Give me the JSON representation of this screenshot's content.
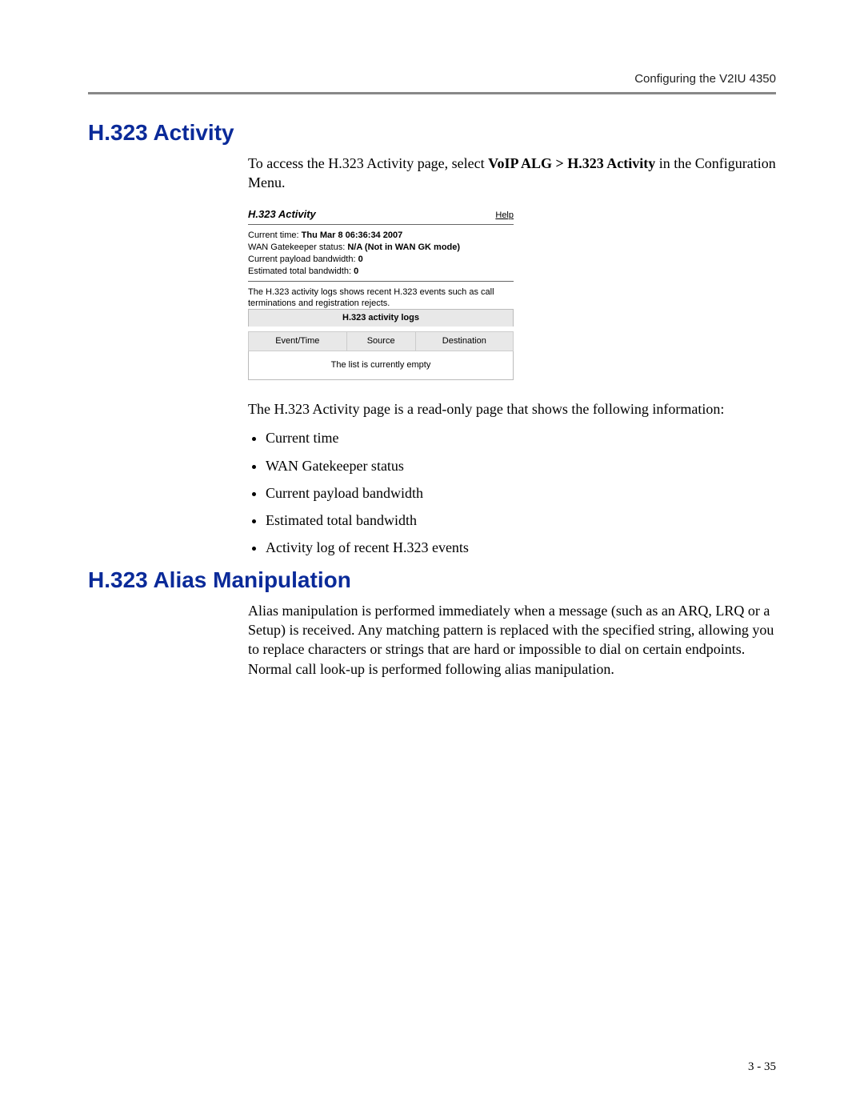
{
  "running_head": "Configuring the V2IU 4350",
  "section1": {
    "heading": "H.323 Activity",
    "intro_pre": "To access the H.323 Activity page, select ",
    "intro_path": "VoIP ALG > H.323 Activity",
    "intro_post": " in the Configuration Menu.",
    "after_panel": "The H.323 Activity page is a read-only page that shows the following information:",
    "bullets": [
      "Current time",
      "WAN Gatekeeper status",
      "Current payload bandwidth",
      "Estimated total bandwidth",
      "Activity log of recent H.323 events"
    ]
  },
  "panel": {
    "title": "H.323 Activity",
    "help": "Help",
    "current_time_label": "Current time: ",
    "current_time_value": "Thu Mar 8 06:36:34 2007",
    "gk_label": "WAN Gatekeeper status: ",
    "gk_value": "N/A (Not in WAN GK mode)",
    "payload_label": "Current payload bandwidth: ",
    "payload_value": "0",
    "est_label": "Estimated total bandwidth: ",
    "est_value": "0",
    "note": "The H.323 activity logs shows recent H.323 events such as call terminations and registration rejects.",
    "table_caption": "H.323 activity logs",
    "cols": [
      "Event/Time",
      "Source",
      "Destination"
    ],
    "empty_msg": "The list is currently empty"
  },
  "section2": {
    "heading": "H.323 Alias Manipulation",
    "para": "Alias manipulation is performed immediately when a message (such as an ARQ, LRQ or a Setup) is received. Any matching pattern is replaced with the specified string, allowing you to replace characters or strings that are hard or impossible to dial on certain endpoints. Normal call look-up is performed following alias manipulation."
  },
  "page_number": "3 - 35"
}
